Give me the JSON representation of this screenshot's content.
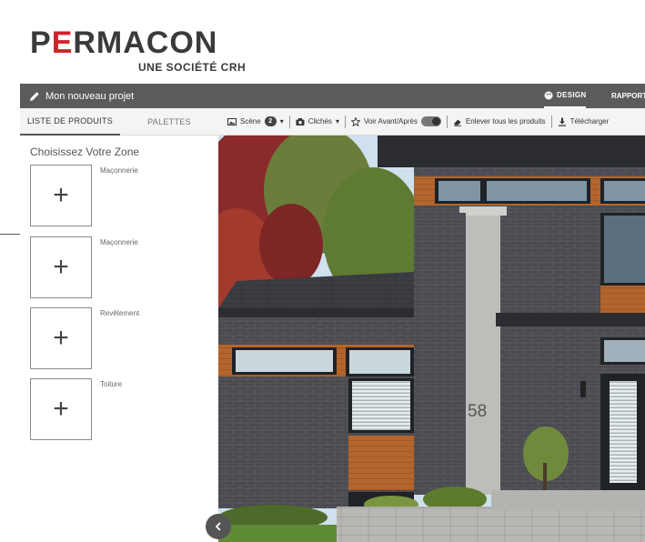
{
  "logo": {
    "brand_prefix": "P",
    "brand_accent": "E",
    "brand_rest": "RMACON",
    "tagline": "UNE SOCIÉTÉ CRH"
  },
  "header": {
    "project_name": "Mon nouveau projet",
    "nav_design": "DESIGN",
    "nav_rapport": "RAPPORT"
  },
  "tabs": {
    "products": "LISTE DE PRODUITS",
    "palettes": "PALETTES"
  },
  "toolbar": {
    "scene_label": "Scène",
    "scene_count": "2",
    "cliches_label": "Clichés",
    "voir_label": "Voir Avant/Après",
    "enlever_label": "Enlever tous les produits",
    "telecharger_label": "Télécharger"
  },
  "panel": {
    "title": "Choisissez Votre Zone",
    "zones": [
      {
        "label": "Maçonnerie"
      },
      {
        "label": "Maçonnerie"
      },
      {
        "label": "Revêtement"
      },
      {
        "label": "Toiture"
      }
    ]
  },
  "scene": {
    "house_number": "58"
  },
  "colors": {
    "brand_accent": "#d2232a",
    "header_bar": "#5b5b5b",
    "brick": "#4a4b50",
    "wood": "#b3652d",
    "sky": "#cfe0ee"
  },
  "icons": {
    "project": "pencil-icon",
    "design": "palette-icon",
    "rapport": "report-icon",
    "scene": "image-icon",
    "cliches": "camera-icon",
    "voir": "star-icon",
    "enlever": "eraser-icon",
    "telecharger": "download-icon",
    "back": "chevron-left-icon"
  }
}
